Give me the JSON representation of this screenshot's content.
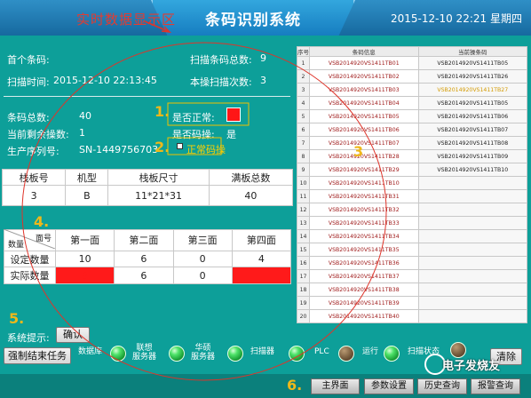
{
  "titlebar": {
    "region_title": "实时数据显示区",
    "title": "条码识别系统",
    "datetime": "2015-12-10  22:21  星期四"
  },
  "scan": {
    "first_code_label": "首个条码:",
    "scan_time_label": "扫描时间:",
    "scan_time": "2015-12-10  22:13:45",
    "total_scans_label": "扫描条码总数:",
    "total_scans": "9",
    "current_scan_label": "本操扫描次数:",
    "current_scan": "3"
  },
  "stats": {
    "total_codes_label": "条码总数:",
    "total_codes": "40",
    "remaining_label": "当前剩余操数:",
    "remaining": "1",
    "serial_label": "生产序列号:",
    "serial": "SN-1449756703",
    "normal_label": "是否正常:",
    "is_code_label": "是否码操:",
    "is_code_value": "是",
    "normal_code_label": "正常码操"
  },
  "pallet_table": {
    "headers": [
      "栈板号",
      "机型",
      "栈板尺寸",
      "满板总数"
    ],
    "row": [
      "3",
      "B",
      "11*21*31",
      "40"
    ]
  },
  "face_table": {
    "corner_top": "面号",
    "corner_bottom": "数量",
    "headers": [
      "第一面",
      "第二面",
      "第三面",
      "第四面"
    ],
    "rows": [
      {
        "label": "设定数量",
        "values": [
          "10",
          "6",
          "0",
          "4"
        ]
      },
      {
        "label": "实际数量",
        "values": [
          "8",
          "6",
          "0",
          ""
        ]
      }
    ]
  },
  "right_table": {
    "headers": [
      "序号",
      "条码信息",
      "当前操条码"
    ],
    "rows": [
      [
        "1",
        "VSB2014920VS1411TB01",
        "VSB2014920VS1411TB05"
      ],
      [
        "2",
        "VSB2014920VS1411TB02",
        "VSB2014920VS1411TB26"
      ],
      [
        "3",
        "VSB2014920VS1411TB03",
        "VSB2014920VS1411TB27"
      ],
      [
        "4",
        "VSB2014920VS1411TB04",
        "VSB2014920VS1411TB05"
      ],
      [
        "5",
        "VSB2014920VS1411TB05",
        "VSB2014920VS1411TB06"
      ],
      [
        "6",
        "VSB2014920VS1411TB06",
        "VSB2014920VS1411TB07"
      ],
      [
        "7",
        "VSB2014920VS1411TB07",
        "VSB2014920VS1411TB08"
      ],
      [
        "8",
        "VSB2014920VS1411TB28",
        "VSB2014920VS1411TB09"
      ],
      [
        "9",
        "VSB2014920VS1411TB29",
        "VSB2014920VS1411TB10"
      ],
      [
        "10",
        "VSB2014920VS1411TB10",
        ""
      ],
      [
        "11",
        "VSB2014920VS1411TB31",
        ""
      ],
      [
        "12",
        "VSB2014920VS1411TB32",
        ""
      ],
      [
        "13",
        "VSB2014920VS1411TB33",
        ""
      ],
      [
        "14",
        "VSB2014920VS1411TB34",
        ""
      ],
      [
        "15",
        "VSB2014920VS1411TB35",
        ""
      ],
      [
        "16",
        "VSB2014920VS1411TB36",
        ""
      ],
      [
        "17",
        "VSB2014920VS1411TB37",
        ""
      ],
      [
        "18",
        "VSB2014920VS1411TB38",
        ""
      ],
      [
        "19",
        "VSB2014920VS1411TB39",
        ""
      ],
      [
        "20",
        "VSB2014920VS1411TB40",
        ""
      ]
    ]
  },
  "system": {
    "prompt_label": "系统提示:",
    "confirm": "确认",
    "force_end": "强制结束任务",
    "clear": "清除",
    "lights": [
      {
        "label": "数据库",
        "on": true
      },
      {
        "label": "联想\n服务器",
        "on": true
      },
      {
        "label": "华硕\n服务器",
        "on": true
      },
      {
        "label": "扫描器",
        "on": true
      },
      {
        "label": "PLC",
        "on": false
      },
      {
        "label": "运行",
        "on": true
      },
      {
        "label": "扫描状态",
        "on": false
      }
    ]
  },
  "nav": {
    "main": "主界面",
    "params": "参数设置",
    "history": "历史查询",
    "alarm": "报警查询"
  },
  "markers": [
    "1.",
    "2.",
    "3",
    "4.",
    "5.",
    "6."
  ],
  "watermark": "电子发烧友",
  "colors": {
    "bg": "#0d9f99",
    "title": "#1678bb",
    "alert": "#ff1a1a",
    "accent": "#e43b30",
    "light_on": "#32d451",
    "light_off": "#6b5135"
  }
}
